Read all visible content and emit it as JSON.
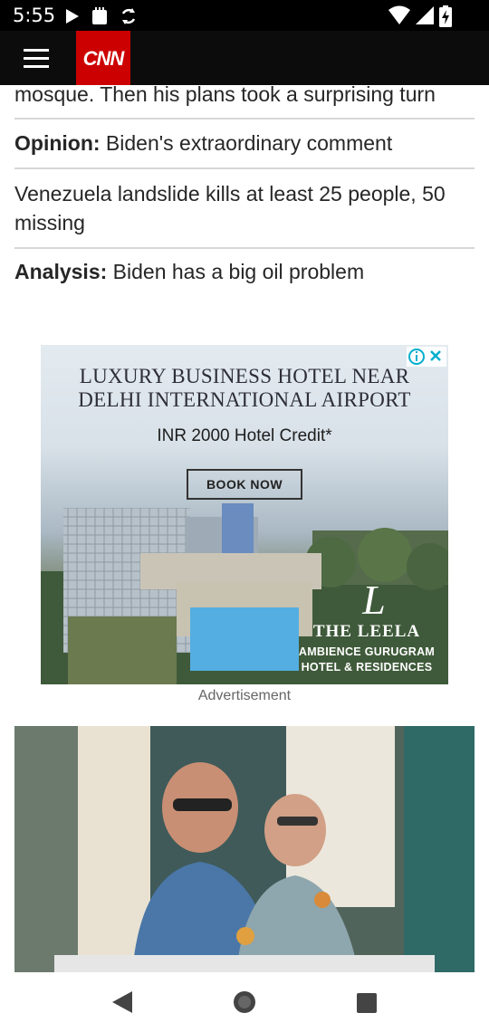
{
  "status_bar": {
    "time": "5:55",
    "left_icons": [
      "play-store-icon",
      "notification-box-icon",
      "sync-icon"
    ],
    "right_icons": [
      "wifi-icon",
      "cellular-signal-icon",
      "battery-charging-icon"
    ]
  },
  "header": {
    "brand": "CNN",
    "brand_color": "#cc0000",
    "menu_icon": "hamburger-menu-icon"
  },
  "headlines": [
    {
      "prefix": "",
      "text": "mosque. Then his plans took a surprising turn"
    },
    {
      "prefix": "Opinion:",
      "text": " Biden's extraordinary comment"
    },
    {
      "prefix": "",
      "text": "Venezuela landslide kills at least 25 people, 50 missing"
    },
    {
      "prefix": "Analysis:",
      "text": " Biden has a big oil problem"
    }
  ],
  "ad": {
    "title_line1": "LUXURY BUSINESS HOTEL NEAR",
    "title_line2": "DELHI INTERNATIONAL AIRPORT",
    "credit": "INR 2000 Hotel Credit*",
    "cta": "BOOK NOW",
    "brand_name": "THE LEELA",
    "brand_sub1": "AMBIENCE GURUGRAM",
    "brand_sub2": "HOTEL & RESIDENCES",
    "label": "Advertisement"
  },
  "nav": {
    "back_icon": "back-triangle-icon",
    "home_icon": "home-circle-icon",
    "recents_icon": "recents-square-icon"
  }
}
